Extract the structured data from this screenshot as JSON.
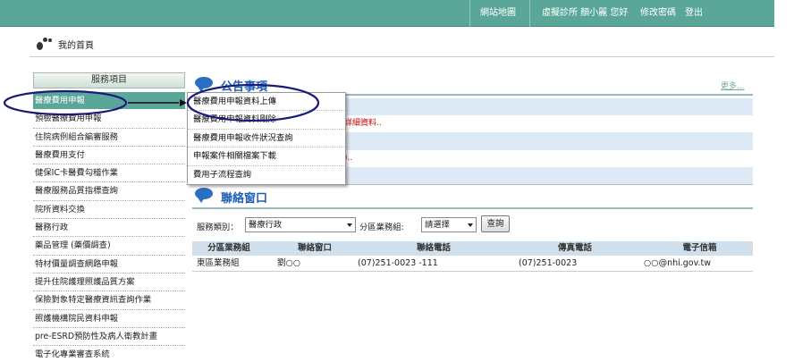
{
  "topbar": {
    "sitemap": "網站地圖",
    "user": "虛擬診所 顏小麗 您好",
    "change_password": "修改密碼",
    "logout": "登出"
  },
  "breadcrumb": {
    "home": "我的首頁"
  },
  "sidebar": {
    "header": "服務項目",
    "items": [
      {
        "label": "醫療費用申報"
      },
      {
        "label": "預檢醫療費用申報"
      },
      {
        "label": "住院病例組合編審服務"
      },
      {
        "label": "醫療費用支付"
      },
      {
        "label": "健保IC卡醫費勾稽作業"
      },
      {
        "label": "醫療服務品質指標查詢"
      },
      {
        "label": "院所資料交換"
      },
      {
        "label": "醫務行政"
      },
      {
        "label": "藥品管理 (藥價調查)"
      },
      {
        "label": "特材價量調查網路申報"
      },
      {
        "label": "提升住院護理照護品質方案"
      },
      {
        "label": "保險對象特定醫療資訊查詢作業"
      },
      {
        "label": "照護機構院民資料申報"
      },
      {
        "label": "pre-ESRD預防性及病人衛教計畫"
      },
      {
        "label": "電子化專業審查系統"
      }
    ]
  },
  "announcements": {
    "title": "公告事項",
    "more": "更多...",
    "rows": [
      "",
      "詳細資料..",
      "",
      ")..",
      ""
    ]
  },
  "submenu": {
    "items": [
      "醫療費用申報資料上傳",
      "醫療費用申報資料剛除",
      "醫療費用申報收件狀況查詢",
      "申報案件相關檔案下載",
      "費用子流程查詢"
    ]
  },
  "contact": {
    "title": "聯絡窗口",
    "category_label": "服務類別：",
    "category_value": "醫療行政",
    "division_label": "分區業務組:",
    "division_value": "請選擇",
    "search_button": "查詢",
    "columns": [
      "分區業務組",
      "聯絡窗口",
      "聯絡電話",
      "傳真電話",
      "電子信箱"
    ],
    "rows": [
      [
        "東區業務組",
        "劉○○",
        "(07)251-0023 -111",
        "(07)251-0023",
        "○○@nhi.gov.tw"
      ]
    ]
  },
  "colors": {
    "topbar": "#5aa79a",
    "active_item": "#5aa79a",
    "title_blue": "#1e5fb3",
    "annotation_navy": "#1a1a7a"
  }
}
